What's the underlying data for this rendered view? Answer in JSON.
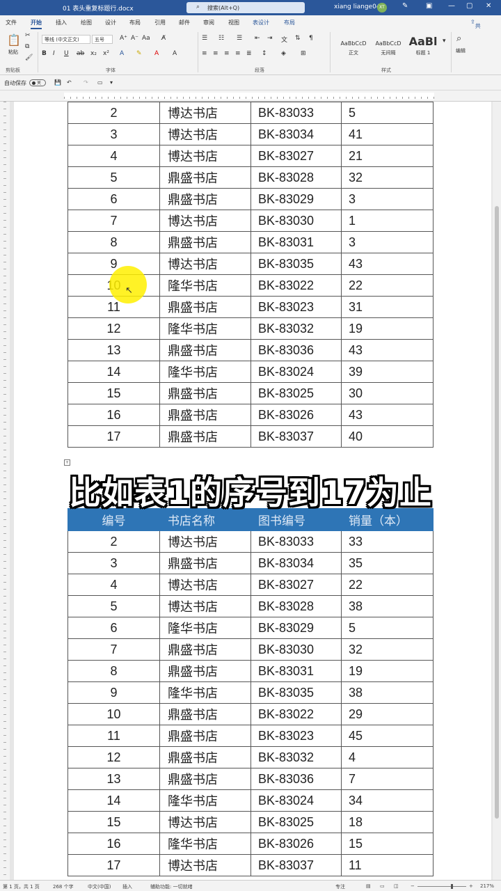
{
  "titlebar": {
    "doc_name": "01 表头重复标题行.docx",
    "search_placeholder": "搜索(Alt+Q)",
    "user": "xiang liange04",
    "avatar": "XT",
    "share": "共享"
  },
  "tabs": [
    "文件",
    "开始",
    "插入",
    "绘图",
    "设计",
    "布局",
    "引用",
    "邮件",
    "审阅",
    "视图",
    "表设计",
    "布局"
  ],
  "active_tab": "开始",
  "ribbon": {
    "clipboard_label": "剪贴板",
    "paste_label": "粘贴",
    "font_name": "等线 (中文正文)",
    "font_size": "五号",
    "font_label": "字体",
    "paragraph_label": "段落",
    "styles_label": "样式",
    "editing_label": "编辑",
    "styles": [
      {
        "preview": "AaBbCcD",
        "name": "正文"
      },
      {
        "preview": "AaBbCcD",
        "name": "无间隔"
      },
      {
        "preview": "AaBl",
        "name": "标题 1"
      }
    ]
  },
  "quickaccess": {
    "autosave_label": "自动保存",
    "autosave_state": "关"
  },
  "table1": [
    {
      "no": "2",
      "store": "博达书店",
      "code": "BK-83033",
      "qty": "5"
    },
    {
      "no": "3",
      "store": "博达书店",
      "code": "BK-83034",
      "qty": "41"
    },
    {
      "no": "4",
      "store": "博达书店",
      "code": "BK-83027",
      "qty": "21"
    },
    {
      "no": "5",
      "store": "鼎盛书店",
      "code": "BK-83028",
      "qty": "32"
    },
    {
      "no": "6",
      "store": "鼎盛书店",
      "code": "BK-83029",
      "qty": "3"
    },
    {
      "no": "7",
      "store": "博达书店",
      "code": "BK-83030",
      "qty": "1"
    },
    {
      "no": "8",
      "store": "鼎盛书店",
      "code": "BK-83031",
      "qty": "3"
    },
    {
      "no": "9",
      "store": "博达书店",
      "code": "BK-83035",
      "qty": "43"
    },
    {
      "no": "10",
      "store": "隆华书店",
      "code": "BK-83022",
      "qty": "22"
    },
    {
      "no": "11",
      "store": "鼎盛书店",
      "code": "BK-83023",
      "qty": "31"
    },
    {
      "no": "12",
      "store": "隆华书店",
      "code": "BK-83032",
      "qty": "19"
    },
    {
      "no": "13",
      "store": "鼎盛书店",
      "code": "BK-83036",
      "qty": "43"
    },
    {
      "no": "14",
      "store": "隆华书店",
      "code": "BK-83024",
      "qty": "39"
    },
    {
      "no": "15",
      "store": "鼎盛书店",
      "code": "BK-83025",
      "qty": "30"
    },
    {
      "no": "16",
      "store": "鼎盛书店",
      "code": "BK-83026",
      "qty": "43"
    },
    {
      "no": "17",
      "store": "鼎盛书店",
      "code": "BK-83037",
      "qty": "40"
    }
  ],
  "table2_header": [
    "编号",
    "书店名称",
    "图书编号",
    "销量（本）"
  ],
  "table2": [
    {
      "no": "2",
      "store": "博达书店",
      "code": "BK-83033",
      "qty": "33"
    },
    {
      "no": "3",
      "store": "鼎盛书店",
      "code": "BK-83034",
      "qty": "35"
    },
    {
      "no": "4",
      "store": "博达书店",
      "code": "BK-83027",
      "qty": "22"
    },
    {
      "no": "5",
      "store": "博达书店",
      "code": "BK-83028",
      "qty": "38"
    },
    {
      "no": "6",
      "store": "隆华书店",
      "code": "BK-83029",
      "qty": "5"
    },
    {
      "no": "7",
      "store": "鼎盛书店",
      "code": "BK-83030",
      "qty": "32"
    },
    {
      "no": "8",
      "store": "鼎盛书店",
      "code": "BK-83031",
      "qty": "19"
    },
    {
      "no": "9",
      "store": "隆华书店",
      "code": "BK-83035",
      "qty": "38"
    },
    {
      "no": "10",
      "store": "鼎盛书店",
      "code": "BK-83022",
      "qty": "29"
    },
    {
      "no": "11",
      "store": "鼎盛书店",
      "code": "BK-83023",
      "qty": "45"
    },
    {
      "no": "12",
      "store": "鼎盛书店",
      "code": "BK-83032",
      "qty": "4"
    },
    {
      "no": "13",
      "store": "鼎盛书店",
      "code": "BK-83036",
      "qty": "7"
    },
    {
      "no": "14",
      "store": "隆华书店",
      "code": "BK-83024",
      "qty": "34"
    },
    {
      "no": "15",
      "store": "博达书店",
      "code": "BK-83025",
      "qty": "18"
    },
    {
      "no": "16",
      "store": "隆华书店",
      "code": "BK-83026",
      "qty": "15"
    },
    {
      "no": "17",
      "store": "博达书店",
      "code": "BK-83037",
      "qty": "11"
    }
  ],
  "caption": "比如表1的序号到17为止",
  "statusbar": {
    "page": "第 1 页，共 1 页",
    "words": "268 个字",
    "lang": "中文(中国)",
    "insert": "插入",
    "accessibility": "辅助功能: 一切就绪",
    "focus": "专注",
    "zoom": "217%"
  },
  "colors": {
    "accent": "#2b579a",
    "table_header": "#2e75b6",
    "cursor_highlight": "#fff000"
  }
}
